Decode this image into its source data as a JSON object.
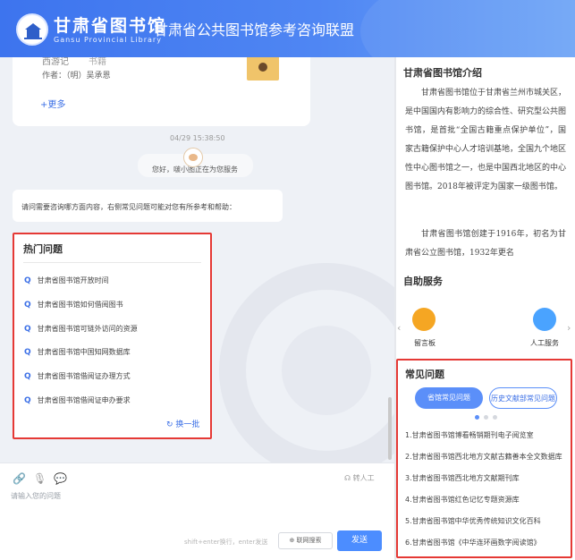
{
  "header": {
    "logo_cn": "甘肃省图书馆",
    "logo_en": "Gansu Provincial Library",
    "title": "甘肃省公共图书馆参考咨询联盟"
  },
  "chat": {
    "book": {
      "title": "西游记",
      "status": "书籍",
      "author": "作者：（明）吴承恩"
    },
    "more_label": "+更多",
    "timestamp": "04/29 15:38:50",
    "greeting": "您好，啵小图正在为您服务",
    "intro": "请问需要咨询哪方面内容，右侧常见问题可能对您有所参考和帮助：",
    "hot": {
      "title": "热门问题",
      "items": [
        "甘肃省图书馆开放时间",
        "甘肃省图书馆如何借阅图书",
        "甘肃省图书馆可链外访问的资源",
        "甘肃省图书馆中国知网数据库",
        "甘肃省图书馆借阅证办理方式",
        "甘肃省图书馆借阅证申办要求"
      ],
      "refresh_label": "换一批"
    }
  },
  "input": {
    "transfer_label": "转人工",
    "placeholder": "请输入您的问题",
    "hint": "shift+enter换行，enter发送",
    "net_search_label": "联网搜索",
    "send_label": "发送"
  },
  "sidebar": {
    "intro_title": "甘肃省图书馆介绍",
    "intro_p1": "甘肃省图书馆位于甘肃省兰州市城关区，是中国国内有影响力的综合性、研究型公共图书馆，是首批“全国古籍重点保护单位”，国家古籍保护中心人才培训基地，全国九个地区性中心图书馆之一，也是中国西北地区的中心图书馆。2018年被评定为国家一级图书馆。",
    "intro_p2": "甘肃省图书馆创建于1916年，初名为甘肃省公立图书馆，1932年更名",
    "self_service_title": "自助服务",
    "services": [
      {
        "label": "留言板",
        "icon": "message-board-icon",
        "color": "#f5a623"
      },
      {
        "label": "人工服务",
        "icon": "human-service-icon",
        "color": "#4aa3ff"
      }
    ],
    "faq": {
      "title": "常见问题",
      "tabs": [
        "省馆常见问题",
        "历史文献部常见问题"
      ],
      "items": [
        "1.甘肃省图书馆博看畅销期刊电子阅览室",
        "2.甘肃省图书馆西北地方文献古籍善本全文数据库",
        "3.甘肃省图书馆西北地方文献期刊库",
        "4.甘肃省图书馆红色记忆专题资源库",
        "5.甘肃省图书馆中华优秀传统知识文化百科",
        "6.甘肃省图书馆《中华连环画数字阅读馆》"
      ]
    }
  },
  "colors": {
    "brand": "#3d74ee",
    "highlight_border": "#e53935",
    "send": "#4c8dff"
  }
}
